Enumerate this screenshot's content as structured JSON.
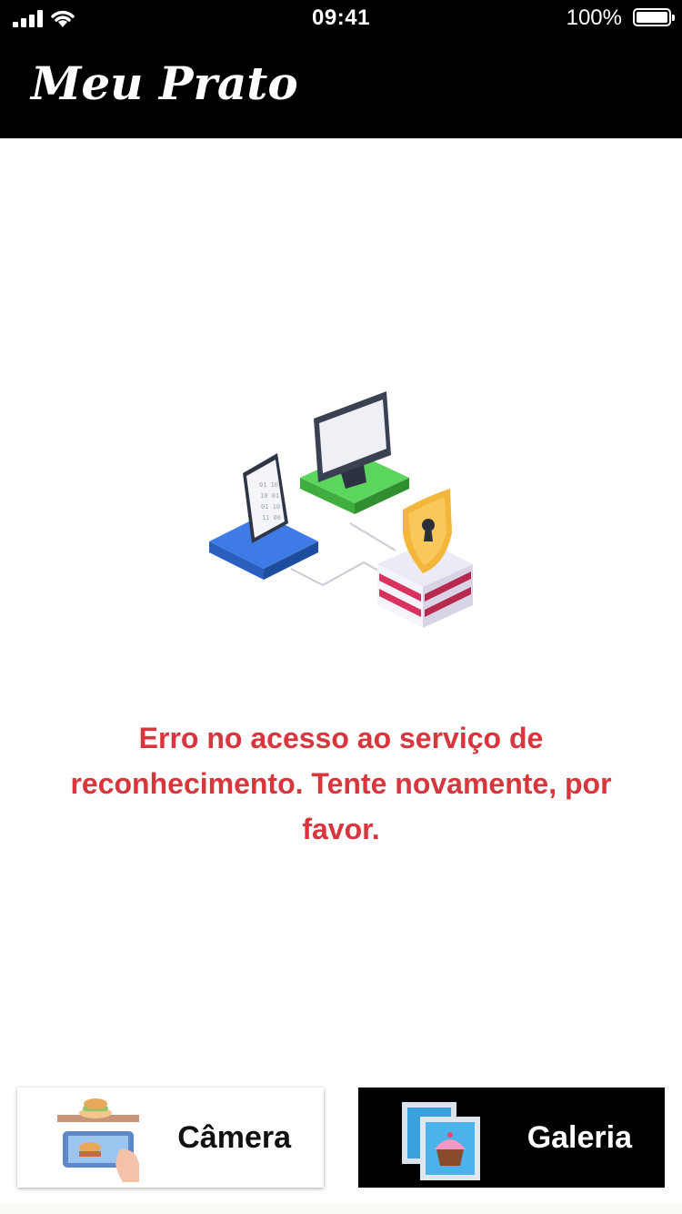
{
  "status_bar": {
    "time": "09:41",
    "battery": "100%"
  },
  "header": {
    "title": "Meu Prato"
  },
  "main": {
    "illustration": "network-security-illustration",
    "error_message": "Erro no acesso ao serviço de reconhecimento. Tente novamente, por favor.",
    "error_color": "#d9353c"
  },
  "buttons": {
    "camera_label": "Câmera",
    "gallery_label": "Galeria"
  },
  "icons": {
    "camera": "camera-food-icon",
    "gallery": "gallery-cupcake-icon"
  }
}
